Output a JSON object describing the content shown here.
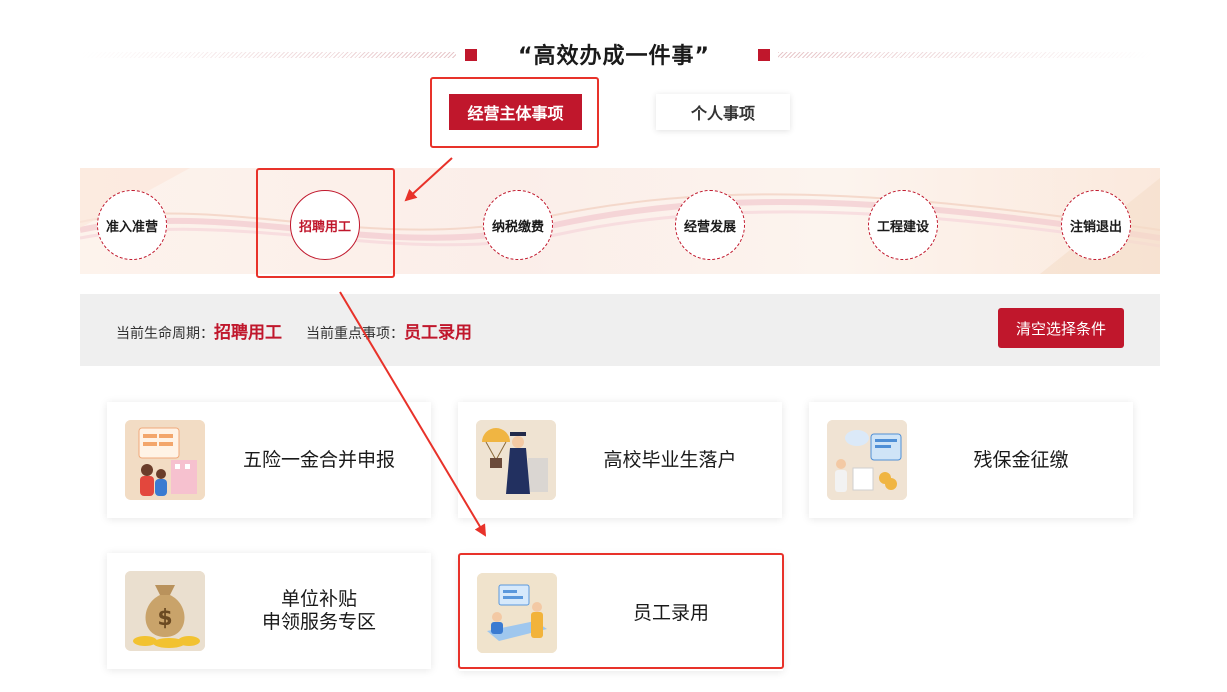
{
  "page": {
    "title": "“高效办成一件事”"
  },
  "tabs": [
    {
      "label": "经营主体事项",
      "active": true
    },
    {
      "label": "个人事项",
      "active": false
    }
  ],
  "lifecycle": {
    "stages": [
      {
        "label": "准入准营",
        "selected": false
      },
      {
        "label": "招聘用工",
        "selected": true
      },
      {
        "label": "纳税缴费",
        "selected": false
      },
      {
        "label": "经营发展",
        "selected": false
      },
      {
        "label": "工程建设",
        "selected": false
      },
      {
        "label": "注销退出",
        "selected": false
      }
    ]
  },
  "status": {
    "period_label": "当前生命周期：",
    "period_value": "招聘用工",
    "focus_label": "当前重点事项：",
    "focus_value": "员工录用",
    "clear_label": "清空选择条件"
  },
  "services": [
    {
      "line1": "五险一金合并申报",
      "line2": "",
      "icon": "insurance-family-illustration"
    },
    {
      "line1": "高校毕业生落户",
      "line2": "",
      "icon": "graduate-illustration"
    },
    {
      "line1": "残保金征缴",
      "line2": "",
      "icon": "office-payment-illustration"
    },
    {
      "line1": "单位补贴",
      "line2": "申领服务专区",
      "icon": "money-bag-illustration"
    },
    {
      "line1": "员工录用",
      "line2": "",
      "icon": "hiring-desk-illustration"
    }
  ],
  "colors": {
    "brand": "#c0172c",
    "annotation": "#e8322a",
    "status_bar_bg": "#efefef"
  }
}
